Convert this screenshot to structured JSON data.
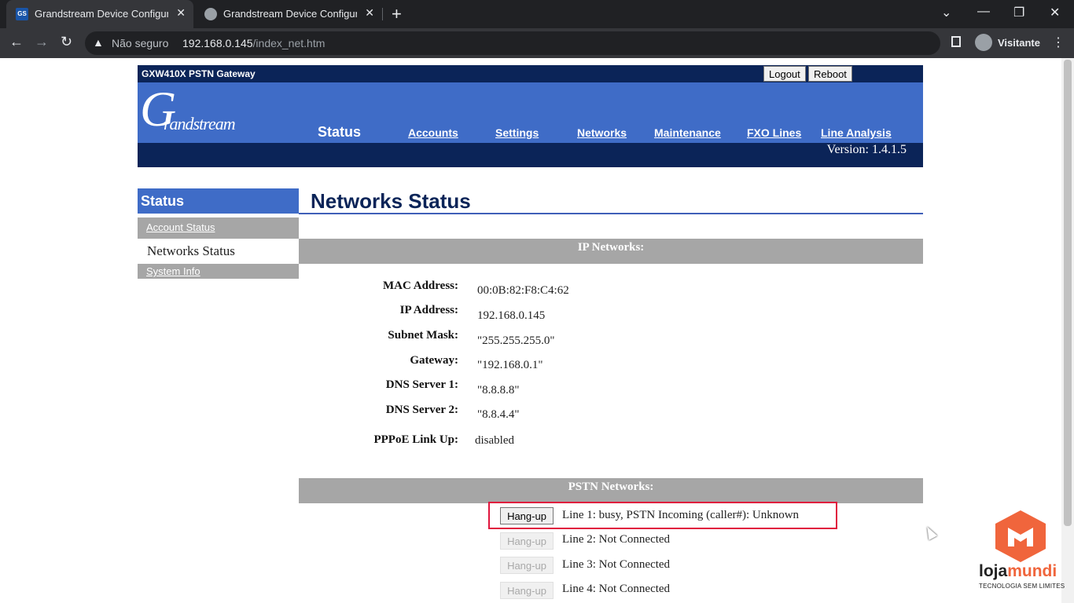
{
  "browser": {
    "tabs": [
      {
        "favicon": "GS",
        "title": "Grandstream Device Configuratio",
        "active": true
      },
      {
        "title": "Grandstream Device Configuratio",
        "active": false
      }
    ],
    "security_label": "Não seguro",
    "url_host": "192.168.0.145",
    "url_path": "/index_net.htm",
    "profile_name": "Visitante"
  },
  "header": {
    "product": "GXW410X PSTN Gateway",
    "logout_label": "Logout",
    "reboot_label": "Reboot",
    "logo_text": "Grandstream",
    "nav": {
      "status": "Status",
      "accounts": "Accounts",
      "settings": "Settings",
      "networks": "Networks",
      "maintenance": "Maintenance",
      "fxo_lines": "FXO Lines",
      "line_analysis": "Line Analysis"
    },
    "version": "Version: 1.4.1.5"
  },
  "sidebar": {
    "heading": "Status",
    "items": [
      "Account Status",
      "Networks Status",
      "System Info"
    ]
  },
  "main": {
    "title": "Networks Status",
    "ip_section": "IP Networks:",
    "fields": {
      "mac_label": "MAC Address:",
      "mac_value": "00:0B:82:F8:C4:62",
      "ip_label": "IP Address:",
      "ip_value": "192.168.0.145",
      "mask_label": "Subnet Mask:",
      "mask_value": "\"255.255.255.0\"",
      "gw_label": "Gateway:",
      "gw_value": "\"192.168.0.1\"",
      "dns1_label": "DNS Server 1:",
      "dns1_value": "\"8.8.8.8\"",
      "dns2_label": "DNS Server 2:",
      "dns2_value": "\"8.8.4.4\"",
      "pppoe_label": "PPPoE Link Up:",
      "pppoe_value": "disabled"
    },
    "pstn_section": "PSTN Networks:",
    "hangup_label": "Hang-up",
    "lines": [
      "Line 1: busy, PSTN Incoming (caller#): Unknown",
      "Line 2: Not Connected",
      "Line 3: Not Connected",
      "Line 4: Not Connected"
    ]
  },
  "watermark": {
    "brand_a": "loja",
    "brand_b": "mundi",
    "tagline": "TECNOLOGIA SEM LIMITES"
  }
}
